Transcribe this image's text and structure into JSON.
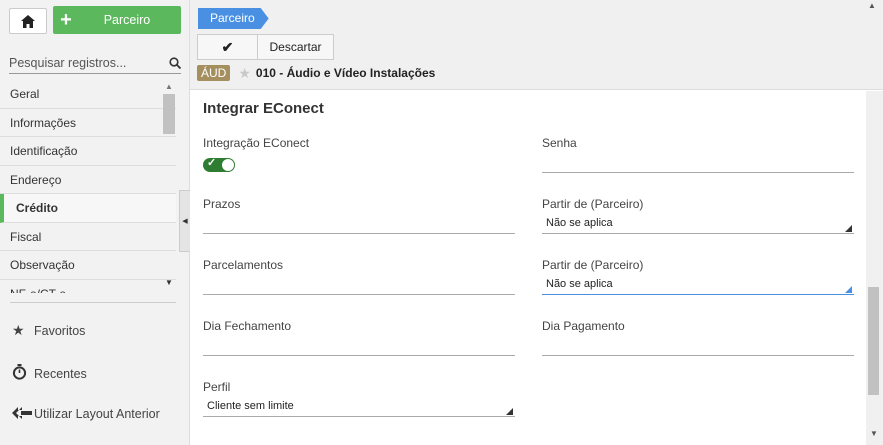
{
  "sidebar": {
    "add_button_label": "Parceiro",
    "search_placeholder": "Pesquisar registros...",
    "items": [
      {
        "label": "Geral"
      },
      {
        "label": "Informações"
      },
      {
        "label": "Identificação"
      },
      {
        "label": "Endereço"
      },
      {
        "label": "Crédito"
      },
      {
        "label": "Fiscal"
      },
      {
        "label": "Observação"
      },
      {
        "label": "NF-e/CT-e"
      }
    ],
    "active_item": "Crédito",
    "favorites_label": "Favoritos",
    "recents_label": "Recentes",
    "layout_label": "Utilizar Layout Anterior"
  },
  "header": {
    "breadcrumb": "Parceiro",
    "discard_label": "Descartar",
    "badge": "ÁUD",
    "record_title": "010 - Áudio e Vídeo Instalações"
  },
  "form": {
    "section_title": "Integrar EConect",
    "integracao_label": "Integração EConect",
    "integracao_enabled": true,
    "senha_label": "Senha",
    "senha_value": "",
    "prazos_label": "Prazos",
    "prazos_value": "",
    "partir1_label": "Partir de (Parceiro)",
    "partir1_value": "Não se aplica",
    "parcelamentos_label": "Parcelamentos",
    "parcelamentos_value": "",
    "partir2_label": "Partir de (Parceiro)",
    "partir2_value": "Não se aplica",
    "dia_fechamento_label": "Dia Fechamento",
    "dia_pagamento_label": "Dia Pagamento",
    "perfil_label": "Perfil",
    "perfil_value": "Cliente sem limite"
  },
  "colors": {
    "accent_green": "#5cb85c",
    "toggle_green": "#2e7d32",
    "breadcrumb_blue": "#4a90e2",
    "badge_brown": "#a58f5e"
  }
}
